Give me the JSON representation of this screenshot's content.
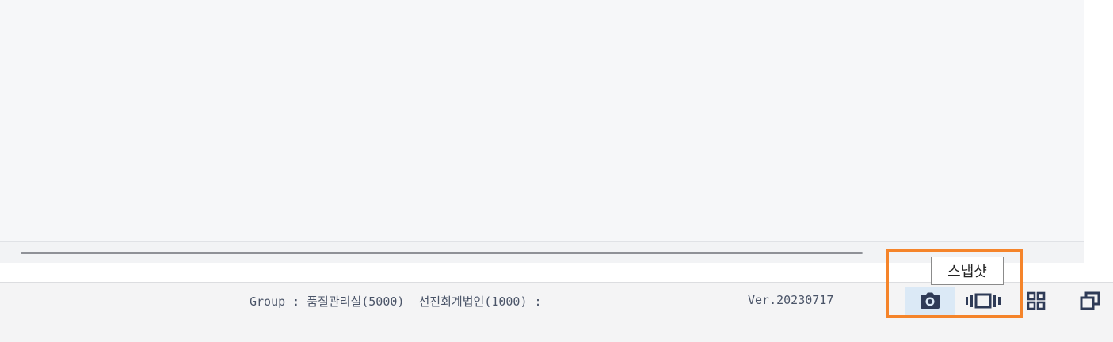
{
  "status_bar": {
    "group_text": "Group : 품질관리실(5000)  선진회계법인(1000) :",
    "version_text": "Ver.20230717"
  },
  "tooltip": {
    "text": "스냅샷"
  },
  "icons": {
    "snapshot": "camera-icon",
    "media": "filmstrip-icon",
    "grid": "grid-icon",
    "window": "restore-window-icon"
  },
  "colors": {
    "highlight": "#f5842a",
    "icon": "#2f3b57",
    "snapshot_hover_bg": "#dbe9f6"
  }
}
